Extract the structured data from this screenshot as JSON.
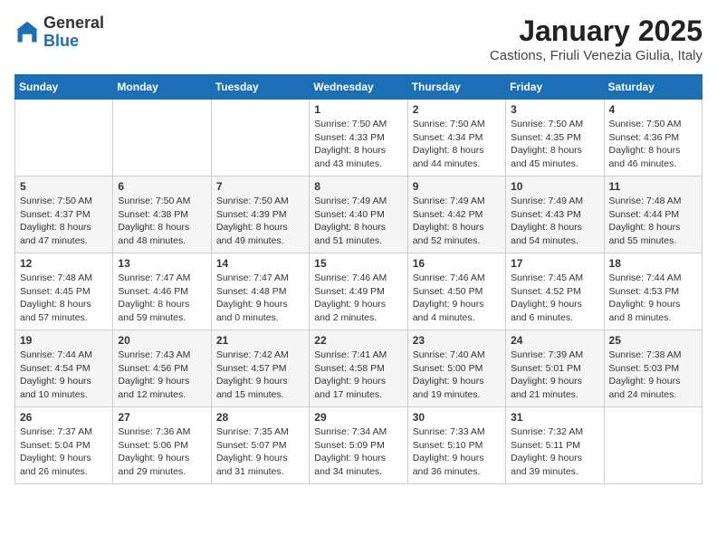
{
  "logo": {
    "general": "General",
    "blue": "Blue"
  },
  "title": "January 2025",
  "subtitle": "Castions, Friuli Venezia Giulia, Italy",
  "days_of_week": [
    "Sunday",
    "Monday",
    "Tuesday",
    "Wednesday",
    "Thursday",
    "Friday",
    "Saturday"
  ],
  "weeks": [
    [
      {
        "day": "",
        "info": ""
      },
      {
        "day": "",
        "info": ""
      },
      {
        "day": "",
        "info": ""
      },
      {
        "day": "1",
        "info": "Sunrise: 7:50 AM\nSunset: 4:33 PM\nDaylight: 8 hours and 43 minutes."
      },
      {
        "day": "2",
        "info": "Sunrise: 7:50 AM\nSunset: 4:34 PM\nDaylight: 8 hours and 44 minutes."
      },
      {
        "day": "3",
        "info": "Sunrise: 7:50 AM\nSunset: 4:35 PM\nDaylight: 8 hours and 45 minutes."
      },
      {
        "day": "4",
        "info": "Sunrise: 7:50 AM\nSunset: 4:36 PM\nDaylight: 8 hours and 46 minutes."
      }
    ],
    [
      {
        "day": "5",
        "info": "Sunrise: 7:50 AM\nSunset: 4:37 PM\nDaylight: 8 hours and 47 minutes."
      },
      {
        "day": "6",
        "info": "Sunrise: 7:50 AM\nSunset: 4:38 PM\nDaylight: 8 hours and 48 minutes."
      },
      {
        "day": "7",
        "info": "Sunrise: 7:50 AM\nSunset: 4:39 PM\nDaylight: 8 hours and 49 minutes."
      },
      {
        "day": "8",
        "info": "Sunrise: 7:49 AM\nSunset: 4:40 PM\nDaylight: 8 hours and 51 minutes."
      },
      {
        "day": "9",
        "info": "Sunrise: 7:49 AM\nSunset: 4:42 PM\nDaylight: 8 hours and 52 minutes."
      },
      {
        "day": "10",
        "info": "Sunrise: 7:49 AM\nSunset: 4:43 PM\nDaylight: 8 hours and 54 minutes."
      },
      {
        "day": "11",
        "info": "Sunrise: 7:48 AM\nSunset: 4:44 PM\nDaylight: 8 hours and 55 minutes."
      }
    ],
    [
      {
        "day": "12",
        "info": "Sunrise: 7:48 AM\nSunset: 4:45 PM\nDaylight: 8 hours and 57 minutes."
      },
      {
        "day": "13",
        "info": "Sunrise: 7:47 AM\nSunset: 4:46 PM\nDaylight: 8 hours and 59 minutes."
      },
      {
        "day": "14",
        "info": "Sunrise: 7:47 AM\nSunset: 4:48 PM\nDaylight: 9 hours and 0 minutes."
      },
      {
        "day": "15",
        "info": "Sunrise: 7:46 AM\nSunset: 4:49 PM\nDaylight: 9 hours and 2 minutes."
      },
      {
        "day": "16",
        "info": "Sunrise: 7:46 AM\nSunset: 4:50 PM\nDaylight: 9 hours and 4 minutes."
      },
      {
        "day": "17",
        "info": "Sunrise: 7:45 AM\nSunset: 4:52 PM\nDaylight: 9 hours and 6 minutes."
      },
      {
        "day": "18",
        "info": "Sunrise: 7:44 AM\nSunset: 4:53 PM\nDaylight: 9 hours and 8 minutes."
      }
    ],
    [
      {
        "day": "19",
        "info": "Sunrise: 7:44 AM\nSunset: 4:54 PM\nDaylight: 9 hours and 10 minutes."
      },
      {
        "day": "20",
        "info": "Sunrise: 7:43 AM\nSunset: 4:56 PM\nDaylight: 9 hours and 12 minutes."
      },
      {
        "day": "21",
        "info": "Sunrise: 7:42 AM\nSunset: 4:57 PM\nDaylight: 9 hours and 15 minutes."
      },
      {
        "day": "22",
        "info": "Sunrise: 7:41 AM\nSunset: 4:58 PM\nDaylight: 9 hours and 17 minutes."
      },
      {
        "day": "23",
        "info": "Sunrise: 7:40 AM\nSunset: 5:00 PM\nDaylight: 9 hours and 19 minutes."
      },
      {
        "day": "24",
        "info": "Sunrise: 7:39 AM\nSunset: 5:01 PM\nDaylight: 9 hours and 21 minutes."
      },
      {
        "day": "25",
        "info": "Sunrise: 7:38 AM\nSunset: 5:03 PM\nDaylight: 9 hours and 24 minutes."
      }
    ],
    [
      {
        "day": "26",
        "info": "Sunrise: 7:37 AM\nSunset: 5:04 PM\nDaylight: 9 hours and 26 minutes."
      },
      {
        "day": "27",
        "info": "Sunrise: 7:36 AM\nSunset: 5:06 PM\nDaylight: 9 hours and 29 minutes."
      },
      {
        "day": "28",
        "info": "Sunrise: 7:35 AM\nSunset: 5:07 PM\nDaylight: 9 hours and 31 minutes."
      },
      {
        "day": "29",
        "info": "Sunrise: 7:34 AM\nSunset: 5:09 PM\nDaylight: 9 hours and 34 minutes."
      },
      {
        "day": "30",
        "info": "Sunrise: 7:33 AM\nSunset: 5:10 PM\nDaylight: 9 hours and 36 minutes."
      },
      {
        "day": "31",
        "info": "Sunrise: 7:32 AM\nSunset: 5:11 PM\nDaylight: 9 hours and 39 minutes."
      },
      {
        "day": "",
        "info": ""
      }
    ]
  ]
}
